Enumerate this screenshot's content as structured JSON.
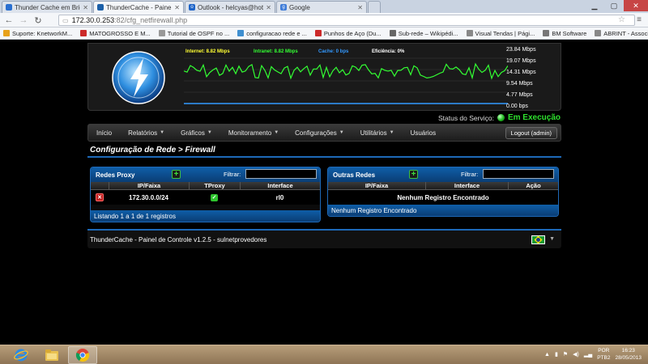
{
  "browser": {
    "tabs": [
      {
        "title": "Thunder Cache em Bridg",
        "color": "#2a6fd0"
      },
      {
        "title": "ThunderCache - Painel de",
        "color": "#1b5fa8"
      },
      {
        "title": "Outlook - helcyas@hotm",
        "color": "#1e64c8"
      },
      {
        "title": "Google",
        "color": "#3d7bd8"
      }
    ],
    "address_host": "172.30.0.253",
    "address_path": ":82/cfg_netfirewall.php",
    "bookmarks": [
      {
        "label": "Suporte: KnetworkM...",
        "color": "#e7a21b"
      },
      {
        "label": "MATOGROSSO E M...",
        "color": "#cc2a2a"
      },
      {
        "label": "Tutorial de OSPF no ...",
        "color": "#999999"
      },
      {
        "label": "configuracao rede e ...",
        "color": "#3f8fd0"
      },
      {
        "label": "Punhos de Aço (Du...",
        "color": "#cc2a2a"
      },
      {
        "label": "Sub-rede – Wikipédi...",
        "color": "#666666"
      },
      {
        "label": "Visual Tendas | Pági...",
        "color": "#888888"
      },
      {
        "label": "BM Software",
        "color": "#777777"
      },
      {
        "label": "ABRINT - Associaçã...",
        "color": "#888888"
      }
    ]
  },
  "graph": {
    "legend": [
      {
        "text": "Internet: 8.82 Mbps",
        "color": "#ffff33"
      },
      {
        "text": "Intranet: 8.82 Mbps",
        "color": "#33ff33"
      },
      {
        "text": "Cache: 0 bps",
        "color": "#3399ff"
      },
      {
        "text": "Eficiência: 0%",
        "color": "#ffffff"
      }
    ],
    "y_ticks": [
      "23.84 Mbps",
      "19.07 Mbps",
      "14.31 Mbps",
      "9.54 Mbps",
      "4.77 Mbps",
      "0.00 bps"
    ]
  },
  "status": {
    "label": "Status do Serviço:",
    "value": "Em Execução"
  },
  "nav": {
    "items": [
      {
        "label": "Início",
        "has_menu": false
      },
      {
        "label": "Relatórios",
        "has_menu": true
      },
      {
        "label": "Gráficos",
        "has_menu": true
      },
      {
        "label": "Monitoramento",
        "has_menu": true
      },
      {
        "label": "Configurações",
        "has_menu": true
      },
      {
        "label": "Utilitários",
        "has_menu": true
      },
      {
        "label": "Usuários",
        "has_menu": false
      }
    ],
    "logout": "Logout (admin)"
  },
  "page_title": "Configuração de Rede > Firewall",
  "proxy": {
    "title": "Redes Proxy",
    "filter_label": "Filtrar:",
    "columns": [
      "",
      "IP/Faixa",
      "TProxy",
      "Interface"
    ],
    "rows": [
      {
        "ip": "172.30.0.0/24",
        "tproxy": true,
        "iface": "rl0"
      }
    ],
    "footer": "Listando 1 a 1 de 1 registros"
  },
  "outras": {
    "title": "Outras Redes",
    "filter_label": "Filtrar:",
    "columns": [
      "IP/Faixa",
      "Interface",
      "Ação"
    ],
    "empty": "Nenhum Registro Encontrado",
    "footer": "Nenhum Registro Encontrado"
  },
  "footer": {
    "text": "ThunderCache - Painel de Controle v1.2.5 - sulnetprovedores"
  },
  "taskbar": {
    "lang_1": "POR",
    "lang_2": "PTB2",
    "time": "16:23",
    "date": "28/05/2013"
  }
}
